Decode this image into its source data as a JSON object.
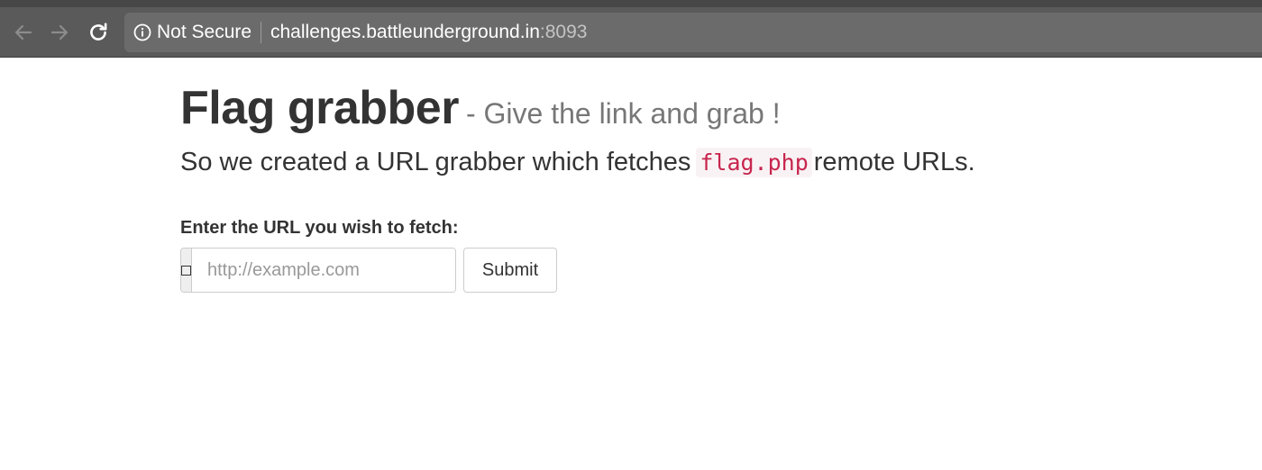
{
  "browser": {
    "security_label": "Not Secure",
    "url_host": "challenges.battleunderground.in",
    "url_port": ":8093",
    "icons": [
      "back-arrow-icon",
      "forward-arrow-icon",
      "reload-icon",
      "info-icon"
    ]
  },
  "page": {
    "title": "Flag grabber",
    "subtitle": "- Give the link and grab !",
    "lead_before": "So we created a URL grabber which fetches",
    "lead_code": "flag.php",
    "lead_after": "remote URLs.",
    "form": {
      "label": "Enter the URL you wish to fetch:",
      "input_placeholder": "http://example.com",
      "input_value": "",
      "submit_label": "Submit"
    }
  },
  "colors": {
    "browser_chrome": "#5a5a5a",
    "code_text": "#c7254e",
    "code_bg": "#f9f2f4",
    "subtitle": "#777777"
  }
}
